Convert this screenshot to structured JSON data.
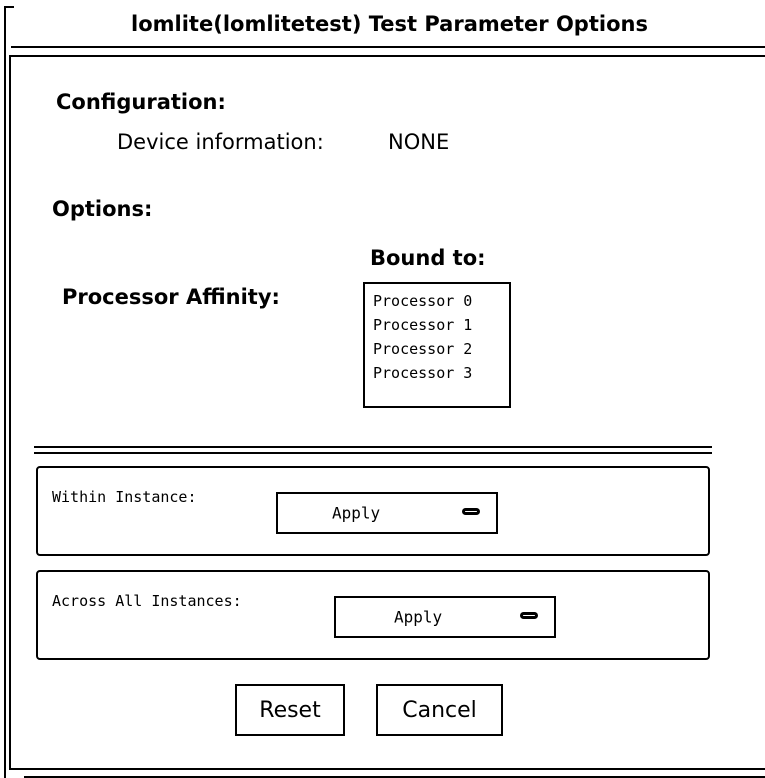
{
  "window": {
    "title": "lomlite(lomlitetest) Test Parameter Options"
  },
  "configuration": {
    "heading": "Configuration:",
    "device_info_label": "Device information:",
    "device_info_value": "NONE"
  },
  "options": {
    "heading": "Options:",
    "bound_to_label": "Bound to:",
    "processor_affinity_label": "Processor Affinity:",
    "processors": [
      "Processor 0",
      "Processor 1",
      "Processor 2",
      "Processor 3"
    ]
  },
  "within_instance": {
    "label": "Within Instance:",
    "button_label": "Apply"
  },
  "across_instances": {
    "label": "Across All Instances:",
    "button_label": "Apply"
  },
  "actions": {
    "reset_label": "Reset",
    "cancel_label": "Cancel"
  },
  "icons": {
    "menu_button_glyph": "menu-indicator-icon"
  }
}
